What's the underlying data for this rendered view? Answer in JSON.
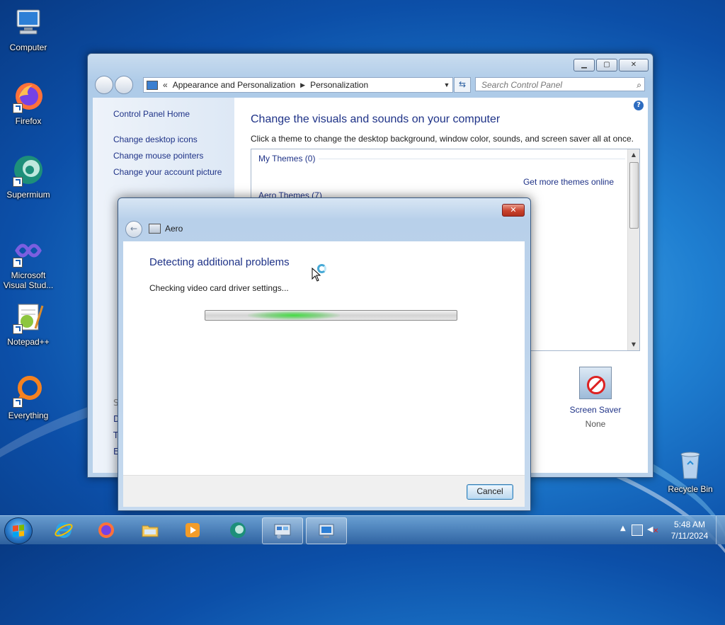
{
  "desktop": {
    "icons": [
      {
        "label": "Computer"
      },
      {
        "label": "Firefox"
      },
      {
        "label": "Supermium"
      },
      {
        "label": "Microsoft Visual Stud..."
      },
      {
        "label": "Notepad++"
      },
      {
        "label": "Everything"
      },
      {
        "label": "Recycle Bin"
      }
    ]
  },
  "control_panel": {
    "breadcrumb": [
      "Appearance and Personalization",
      "Personalization"
    ],
    "breadcrumb_prefix": "«",
    "search_placeholder": "Search Control Panel",
    "left_links": [
      "Control Panel Home",
      "Change desktop icons",
      "Change mouse pointers",
      "Change your account picture"
    ],
    "left_partial": [
      "S",
      "D",
      "T",
      "E"
    ],
    "title": "Change the visuals and sounds on your computer",
    "subtitle": "Click a theme to change the desktop background, window color, sounds, and screen saver all at once.",
    "groups": {
      "my_themes": "My Themes (0)",
      "get_more": "Get more themes online",
      "aero_themes": "Aero Themes (7)"
    },
    "screen_saver": {
      "label": "Screen Saver",
      "value": "None"
    }
  },
  "dialog": {
    "title": "Aero",
    "heading": "Detecting additional problems",
    "status": "Checking video card driver settings...",
    "cancel_label": "Cancel",
    "progress_state": "indeterminate"
  },
  "taskbar": {
    "pinned": [
      "Internet Explorer",
      "Firefox",
      "Windows Explorer",
      "Windows Media Player",
      "Supermium",
      "Control Panel",
      "Aero troubleshooter"
    ],
    "clock": {
      "time": "5:48 AM",
      "date": "7/11/2024"
    }
  },
  "colors": {
    "link_blue": "#1e3287",
    "progress_green": "#3cdc3c",
    "close_red": "#c9412c"
  }
}
